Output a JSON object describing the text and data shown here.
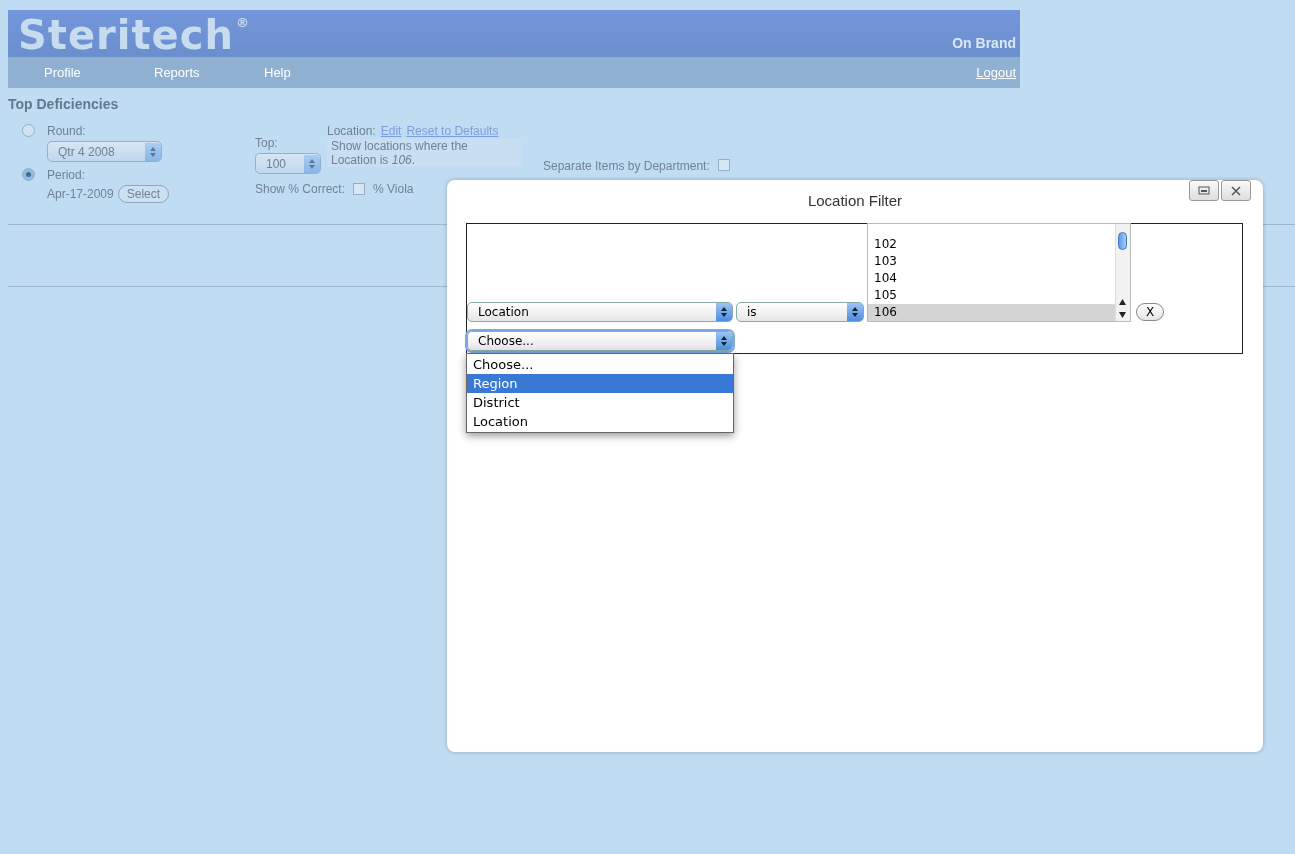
{
  "header": {
    "logo": "Steritech",
    "registered": "®",
    "brand": "On Brand",
    "logout": "Logout",
    "nav": [
      {
        "label": "Profile"
      },
      {
        "label": "Reports"
      },
      {
        "label": "Help"
      }
    ]
  },
  "page": {
    "title": "Top Deficiencies",
    "round": {
      "label": "Round:",
      "selected": false,
      "value": "Qtr 4 2008"
    },
    "period": {
      "label": "Period:",
      "selected": true,
      "value": "Apr-17-2009",
      "button": "Select"
    },
    "top": {
      "label": "Top:",
      "value": "100"
    },
    "location": {
      "label": "Location:",
      "edit": "Edit",
      "reset": "Reset to Defaults",
      "description": "Show locations where the Location is *106*."
    },
    "show_correct": {
      "label": "Show % Correct:",
      "checked": false
    },
    "violations_label": "% Viola",
    "separate": {
      "label": "Separate Items by Department:",
      "checked": false
    }
  },
  "modal": {
    "title": "Location Filter",
    "rule": {
      "field": "Location",
      "operator": "is",
      "remove": "X",
      "values": [
        {
          "label": "102",
          "selected": false
        },
        {
          "label": "103",
          "selected": false
        },
        {
          "label": "104",
          "selected": false
        },
        {
          "label": "105",
          "selected": false
        },
        {
          "label": "106",
          "selected": true
        }
      ]
    },
    "new_field": "Choose...",
    "dropdown": [
      {
        "label": "Choose...",
        "selected": false
      },
      {
        "label": "Region",
        "selected": true
      },
      {
        "label": "District",
        "selected": false
      },
      {
        "label": "Location",
        "selected": false
      }
    ]
  }
}
